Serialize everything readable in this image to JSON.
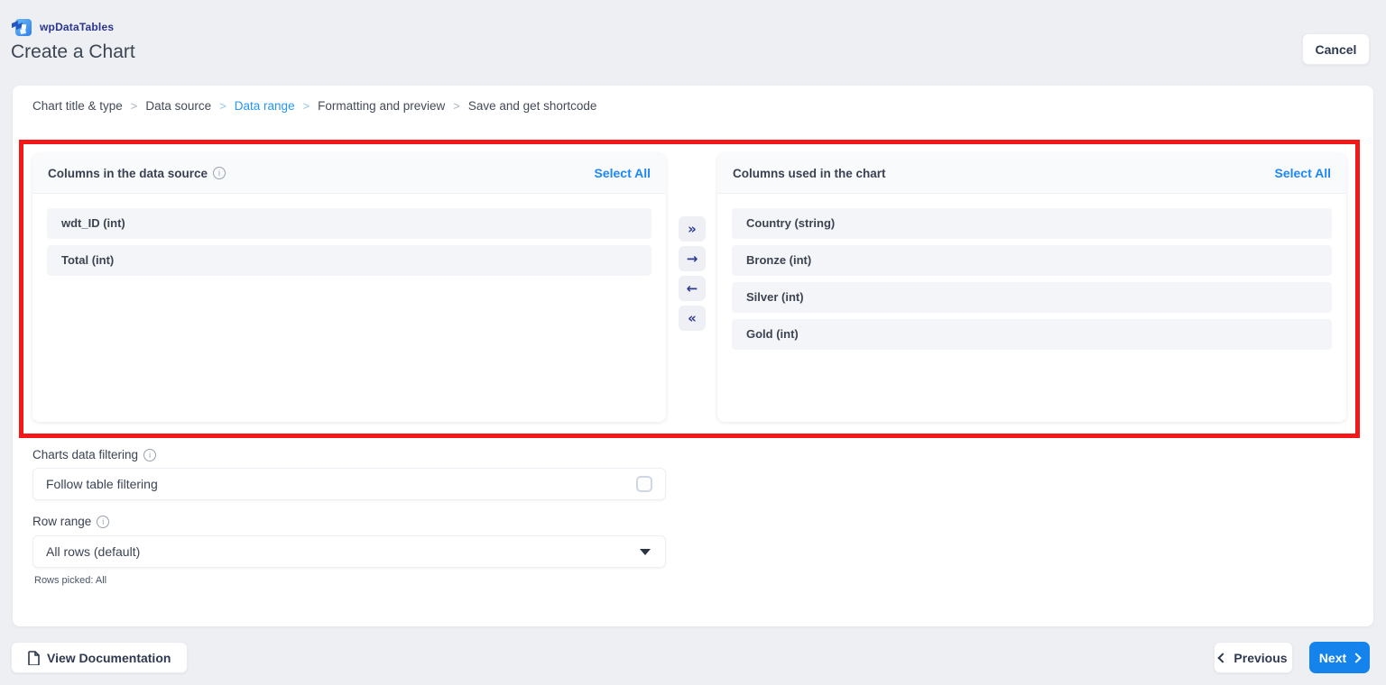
{
  "header": {
    "logo_text": "wpDataTables",
    "page_title": "Create a Chart",
    "cancel_label": "Cancel"
  },
  "breadcrumb": {
    "separator": ">",
    "items": [
      {
        "label": "Chart title & type",
        "active": false
      },
      {
        "label": "Data source",
        "active": false
      },
      {
        "label": "Data range",
        "active": true
      },
      {
        "label": "Formatting and preview",
        "active": false
      },
      {
        "label": "Save and get shortcode",
        "active": false
      }
    ]
  },
  "columns_panels": {
    "source": {
      "title": "Columns in the data source",
      "select_all_label": "Select All",
      "items": [
        "wdt_ID (int)",
        "Total (int)"
      ]
    },
    "chart": {
      "title": "Columns used in the chart",
      "select_all_label": "Select All",
      "items": [
        "Country (string)",
        "Bronze (int)",
        "Silver (int)",
        "Gold (int)"
      ]
    },
    "transfer_buttons": {
      "move_all_right": "»",
      "move_right": "→",
      "move_left": "←",
      "move_all_left": "«"
    }
  },
  "filtering": {
    "label": "Charts data filtering",
    "checkbox_label": "Follow table filtering",
    "checked": false
  },
  "row_range": {
    "label": "Row range",
    "selected_value": "All rows (default)",
    "note": "Rows picked: All"
  },
  "footer": {
    "view_docs_label": "View Documentation",
    "previous_label": "Previous",
    "next_label": "Next"
  },
  "colors": {
    "accent_blue": "#1583ec",
    "breadcrumb_active_blue": "#2696f5",
    "select_all_blue": "#1e88f7",
    "annotation_red": "#f51717",
    "brand_indigo": "#2b3490",
    "dark_text": "#3b4454",
    "page_background": "#edeff2"
  }
}
